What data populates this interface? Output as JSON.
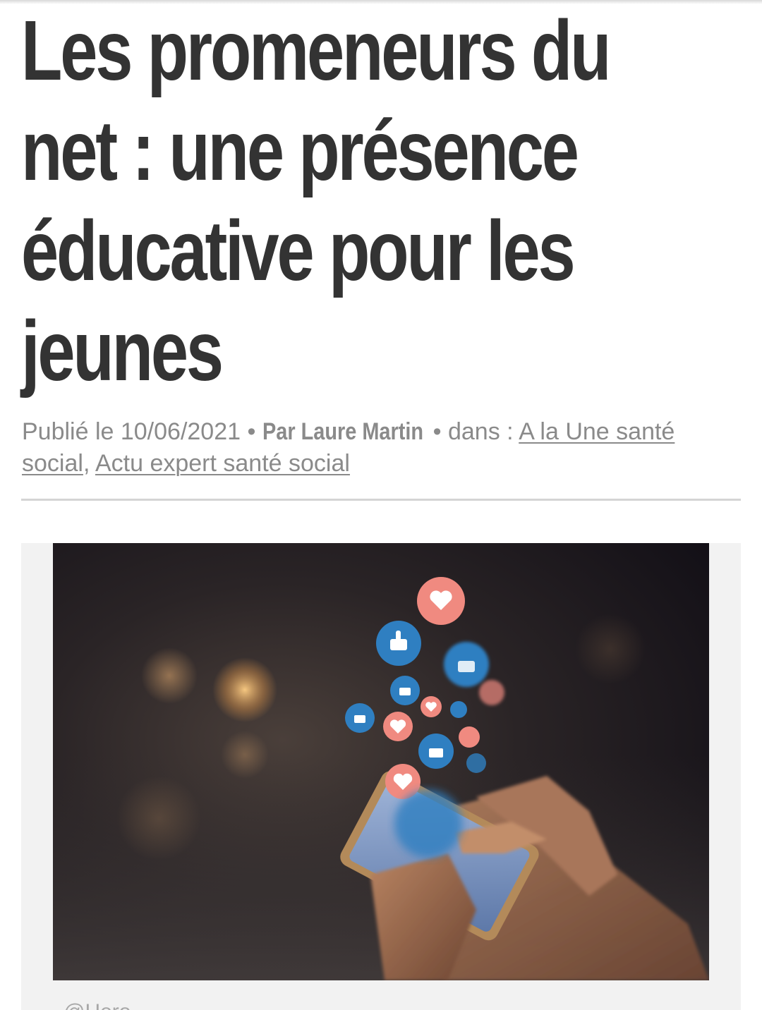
{
  "article": {
    "title_lines": [
      "Les promeneurs du",
      "net : une présence",
      "éducative pour les",
      "jeunes"
    ],
    "published_label": "Publié le 10/06/2021",
    "separator": "•",
    "author": "Par Laure Martin",
    "in_label": "dans :",
    "categories": [
      "A la Une santé social",
      "Actu expert santé social"
    ],
    "category_separator": ","
  },
  "figure": {
    "image_description_icon": "phone-with-like-and-heart-bubbles",
    "caption": "@Hero..."
  },
  "colors": {
    "title": "#333333",
    "meta": "#8a8a8a",
    "like_blue": "#2f7fc1",
    "heart_pink": "#f08a80"
  }
}
